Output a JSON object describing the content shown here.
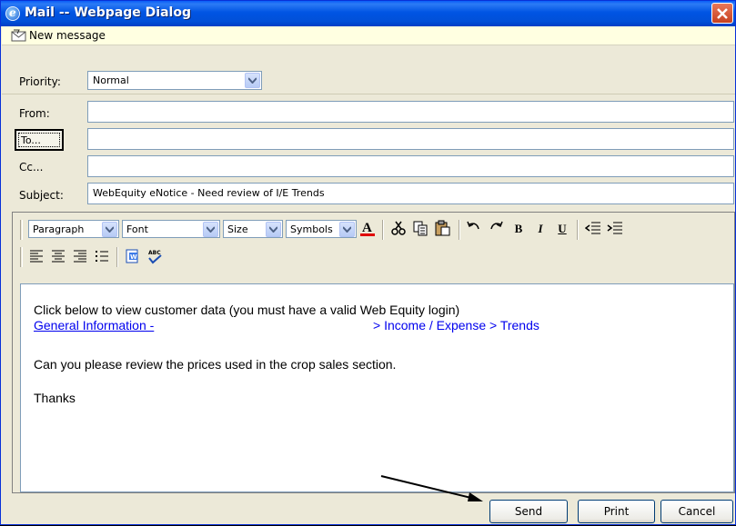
{
  "window": {
    "title": "Mail -- Webpage Dialog",
    "title_icon": "ie-icon",
    "close_icon": "close-icon"
  },
  "message_bar": {
    "label": "New message",
    "icon": "new-message-icon"
  },
  "form": {
    "priority_label": "Priority:",
    "priority_value": "Normal",
    "from_label": "From:",
    "from_value": "",
    "to_button": "To...",
    "to_value": "",
    "cc_label": "Cc...",
    "cc_value": "",
    "subject_label": "Subject:",
    "subject_value": "WebEquity eNotice - Need review of I/E Trends"
  },
  "toolbar": {
    "paragraph": "Paragraph",
    "font": "Font",
    "size": "Size",
    "symbols": "Symbols",
    "bold": "B",
    "italic": "I",
    "underline": "U",
    "icons": [
      "font-color-icon",
      "cut-icon",
      "copy-icon",
      "paste-icon",
      "undo-icon",
      "redo-icon",
      "bold-icon",
      "italic-icon",
      "underline-icon",
      "outdent-icon",
      "indent-icon",
      "align-left-icon",
      "align-center-icon",
      "align-right-icon",
      "bullet-list-icon",
      "insert-word-icon",
      "spell-check-icon"
    ]
  },
  "body": {
    "line1": "Click below to view customer data (you must have a valid Web Equity login)",
    "link_part1": "General Information -",
    "link_part2": "> Income / Expense > Trends",
    "line3": "Can you please review the prices used in the crop sales section.",
    "line4": "Thanks"
  },
  "buttons": {
    "send": "Send",
    "print": "Print",
    "cancel": "Cancel"
  }
}
